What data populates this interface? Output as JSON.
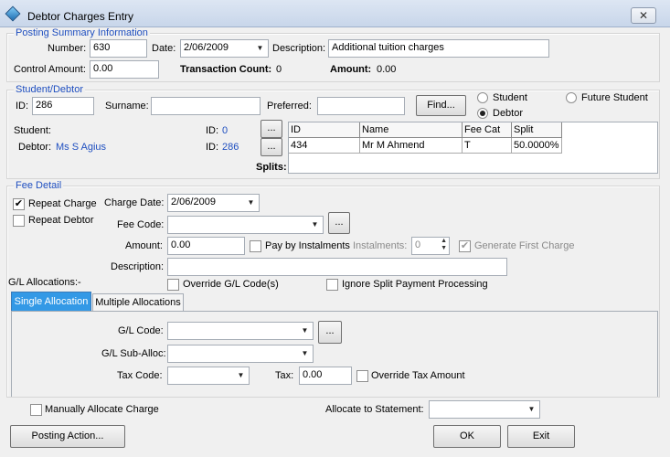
{
  "window": {
    "title": "Debtor Charges Entry",
    "close_glyph": "✕"
  },
  "posting": {
    "legend": "Posting Summary Information",
    "number_label": "Number:",
    "number_value": "630",
    "date_label": "Date:",
    "date_value": "2/06/2009",
    "description_label": "Description:",
    "description_value": "Additional tuition charges",
    "control_amount_label": "Control Amount:",
    "control_amount_value": "0.00",
    "transaction_count_label": "Transaction Count:",
    "transaction_count_value": "0",
    "amount_label": "Amount:",
    "amount_value": "0.00"
  },
  "student_debtor": {
    "legend": "Student/Debtor",
    "id_label": "ID:",
    "id_value": "286",
    "surname_label": "Surname:",
    "surname_value": "",
    "preferred_label": "Preferred:",
    "preferred_value": "",
    "find_label": "Find...",
    "radio_student": "Student",
    "radio_future": "Future Student",
    "radio_debtor": "Debtor",
    "selected_radio": "Debtor",
    "student_label": "Student:",
    "student_id_label": "ID:",
    "student_id_value": "0",
    "debtor_label": "Debtor:",
    "debtor_name": "Ms S Agius",
    "debtor_id_label": "ID:",
    "debtor_id_value": "286",
    "ellipsis": "...",
    "splits_label": "Splits:",
    "splits_columns": [
      "ID",
      "Name",
      "Fee Cat",
      "Split"
    ],
    "splits_rows": [
      [
        "434",
        "Mr M Ahmend",
        "T",
        "50.0000%"
      ]
    ]
  },
  "fee_detail": {
    "legend": "Fee Detail",
    "repeat_charge_label": "Repeat Charge",
    "repeat_charge_checked": true,
    "repeat_debtor_label": "Repeat Debtor",
    "repeat_debtor_checked": false,
    "charge_date_label": "Charge Date:",
    "charge_date_value": "2/06/2009",
    "fee_code_label": "Fee Code:",
    "fee_code_value": "",
    "amount_label": "Amount:",
    "amount_value": "0.00",
    "pay_by_instalments_label": "Pay by Instalments",
    "instalments_label": "Instalments:",
    "instalments_value": "0",
    "generate_first_charge_label": "Generate First Charge",
    "description_label": "Description:",
    "description_value": "",
    "gl_allocations_label": "G/L Allocations:-",
    "override_gl_label": "Override G/L Code(s)",
    "ignore_split_label": "Ignore Split Payment Processing",
    "tabs": [
      "Single Allocation",
      "Multiple Allocations"
    ],
    "active_tab": "Single Allocation",
    "gl_code_label": "G/L Code:",
    "gl_code_value": "",
    "gl_sub_alloc_label": "G/L Sub-Alloc:",
    "gl_sub_alloc_value": "",
    "tax_code_label": "Tax Code:",
    "tax_code_value": "",
    "tax_label": "Tax:",
    "tax_value": "0.00",
    "override_tax_label": "Override Tax Amount"
  },
  "bottom": {
    "manually_allocate_label": "Manually Allocate Charge",
    "allocate_statement_label": "Allocate to Statement:",
    "allocate_statement_value": "",
    "posting_action_label": "Posting Action...",
    "ok_label": "OK",
    "exit_label": "Exit"
  },
  "icons": {
    "dropdown": "chevron-down-icon",
    "spin": "spin-arrows-icon",
    "check": "checkmark-icon",
    "app": "app-diamond-icon"
  },
  "colors": {
    "accent": "#1f4fc0",
    "active_tab": "#3399e6",
    "window_bg": "#f0f0f0"
  }
}
